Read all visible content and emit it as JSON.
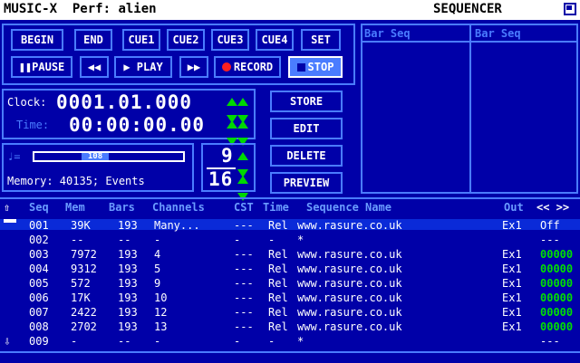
{
  "titlebar": {
    "app": "MUSIC-X",
    "perf": "Perf: alien",
    "module": "SEQUENCER"
  },
  "transport": {
    "row1": [
      "BEGIN",
      "END",
      "CUE1",
      "CUE2",
      "CUE3",
      "CUE4",
      "SET"
    ],
    "pause": "PAUSE",
    "play": "PLAY",
    "record": "RECORD",
    "stop": "STOP"
  },
  "clock": {
    "clock_label": "Clock:",
    "clock_value": "0001.01.000",
    "time_label": "Time:",
    "time_value": "00:00:00.00"
  },
  "tempo": {
    "value": "108",
    "fill_fraction": 0.39
  },
  "memory": {
    "text": "Memory: 40135; Events"
  },
  "meter": {
    "numerator": "9",
    "denominator": "16"
  },
  "actions": [
    "STORE",
    "EDIT",
    "DELETE",
    "PREVIEW"
  ],
  "barseq": {
    "col1": "Bar Seq",
    "col2": "Bar Seq"
  },
  "table": {
    "headers": {
      "seq": "Seq",
      "mem": "Mem",
      "bars": "Bars",
      "channels": "Channels",
      "cst": "CST",
      "time": "Time",
      "name": "Sequence Name",
      "out": "Out",
      "nav": "<< >>"
    },
    "rows": [
      {
        "seq": "001",
        "mem": "39K",
        "bars": "193",
        "ch": "Many...",
        "cst": "---",
        "time": "Rel",
        "name": "www.rasure.co.uk",
        "out": "Ex1",
        "flag": "Off"
      },
      {
        "seq": "002",
        "mem": "--",
        "bars": "--",
        "ch": "-",
        "cst": "-",
        "time": "-",
        "name": "*",
        "out": "",
        "flag": "---"
      },
      {
        "seq": "003",
        "mem": "7972",
        "bars": "193",
        "ch": "4",
        "cst": "---",
        "time": "Rel",
        "name": "www.rasure.co.uk",
        "out": "Ex1",
        "flag": "00000"
      },
      {
        "seq": "004",
        "mem": "9312",
        "bars": "193",
        "ch": "5",
        "cst": "---",
        "time": "Rel",
        "name": "www.rasure.co.uk",
        "out": "Ex1",
        "flag": "00000"
      },
      {
        "seq": "005",
        "mem": "572",
        "bars": "193",
        "ch": "9",
        "cst": "---",
        "time": "Rel",
        "name": "www.rasure.co.uk",
        "out": "Ex1",
        "flag": "00000"
      },
      {
        "seq": "006",
        "mem": "17K",
        "bars": "193",
        "ch": "10",
        "cst": "---",
        "time": "Rel",
        "name": "www.rasure.co.uk",
        "out": "Ex1",
        "flag": "00000"
      },
      {
        "seq": "007",
        "mem": "2422",
        "bars": "193",
        "ch": "12",
        "cst": "---",
        "time": "Rel",
        "name": "www.rasure.co.uk",
        "out": "Ex1",
        "flag": "00000"
      },
      {
        "seq": "008",
        "mem": "2702",
        "bars": "193",
        "ch": "13",
        "cst": "---",
        "time": "Rel",
        "name": "www.rasure.co.uk",
        "out": "Ex1",
        "flag": "00000"
      },
      {
        "seq": "009",
        "mem": "-",
        "bars": "--",
        "ch": "-",
        "cst": "-",
        "time": "-",
        "name": "*",
        "out": "",
        "flag": "---"
      }
    ]
  }
}
